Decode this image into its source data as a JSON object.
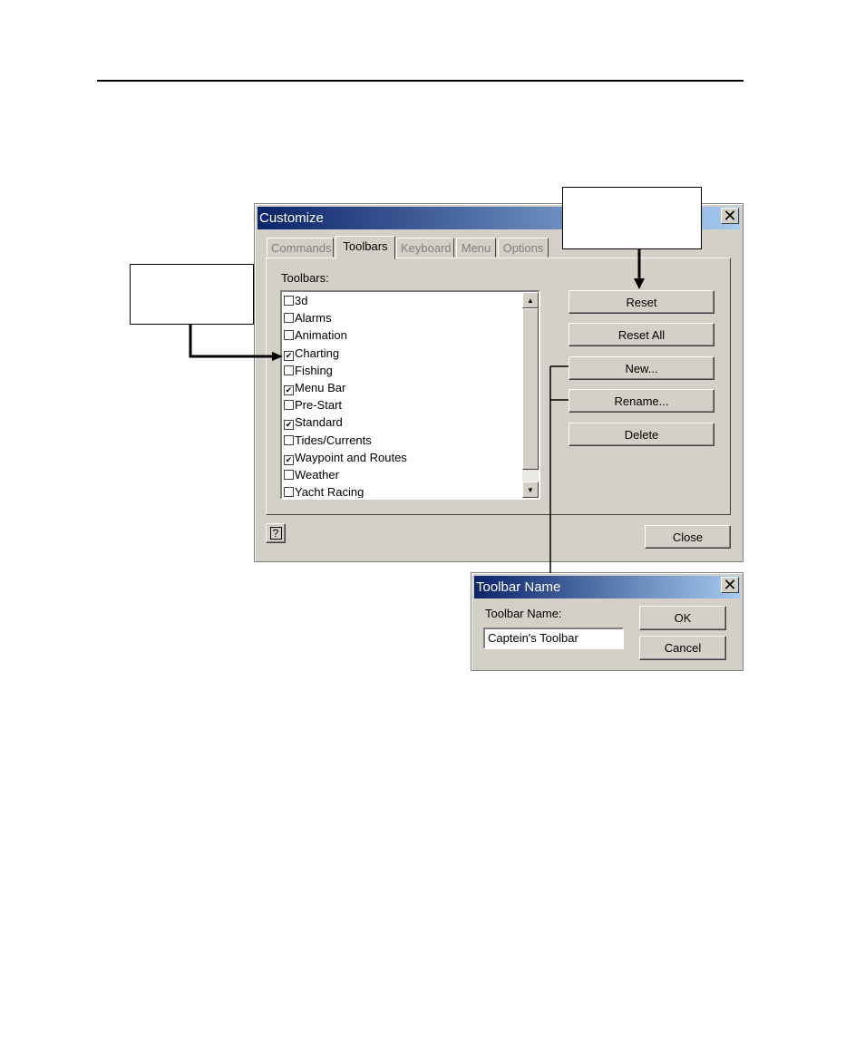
{
  "customize": {
    "title": "Customize",
    "tabs": [
      {
        "label": "Commands",
        "active": false
      },
      {
        "label": "Toolbars",
        "active": true
      },
      {
        "label": "Keyboard",
        "active": false
      },
      {
        "label": "Menu",
        "active": false
      },
      {
        "label": "Options",
        "active": false
      }
    ],
    "list_label": "Toolbars:",
    "toolbars": [
      {
        "label": "3d",
        "checked": false
      },
      {
        "label": "Alarms",
        "checked": false
      },
      {
        "label": "Animation",
        "checked": false
      },
      {
        "label": "Charting",
        "checked": true
      },
      {
        "label": "Fishing",
        "checked": false
      },
      {
        "label": "Menu Bar",
        "checked": true
      },
      {
        "label": "Pre-Start",
        "checked": false
      },
      {
        "label": "Standard",
        "checked": true
      },
      {
        "label": "Tides/Currents",
        "checked": false
      },
      {
        "label": "Waypoint and Routes",
        "checked": true
      },
      {
        "label": "Weather",
        "checked": false
      },
      {
        "label": "Yacht Racing",
        "checked": false
      }
    ],
    "buttons": {
      "reset": "Reset",
      "reset_all": "Reset All",
      "new": "New...",
      "rename": "Rename...",
      "delete": "Delete",
      "close": "Close"
    }
  },
  "toolbar_name_dialog": {
    "title": "Toolbar Name",
    "field_label": "Toolbar Name:",
    "field_value": "Captein's Toolbar",
    "ok": "OK",
    "cancel": "Cancel"
  },
  "colors": {
    "titlebar_start": "#0a246a",
    "titlebar_end": "#a6caf0",
    "dialog_face": "#d4d0c8"
  }
}
